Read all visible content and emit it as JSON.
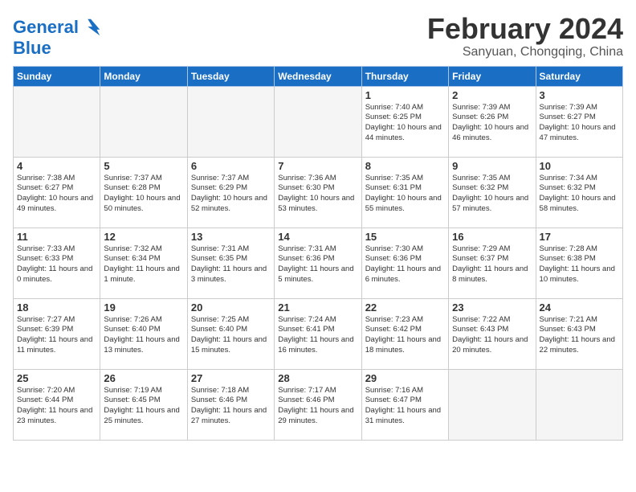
{
  "header": {
    "logo_line1": "General",
    "logo_line2": "Blue",
    "month_year": "February 2024",
    "location": "Sanyuan, Chongqing, China"
  },
  "weekdays": [
    "Sunday",
    "Monday",
    "Tuesday",
    "Wednesday",
    "Thursday",
    "Friday",
    "Saturday"
  ],
  "weeks": [
    [
      {
        "day": "",
        "sunrise": "",
        "sunset": "",
        "daylight": ""
      },
      {
        "day": "",
        "sunrise": "",
        "sunset": "",
        "daylight": ""
      },
      {
        "day": "",
        "sunrise": "",
        "sunset": "",
        "daylight": ""
      },
      {
        "day": "",
        "sunrise": "",
        "sunset": "",
        "daylight": ""
      },
      {
        "day": "1",
        "sunrise": "7:40 AM",
        "sunset": "6:25 PM",
        "daylight": "10 hours and 44 minutes."
      },
      {
        "day": "2",
        "sunrise": "7:39 AM",
        "sunset": "6:26 PM",
        "daylight": "10 hours and 46 minutes."
      },
      {
        "day": "3",
        "sunrise": "7:39 AM",
        "sunset": "6:27 PM",
        "daylight": "10 hours and 47 minutes."
      }
    ],
    [
      {
        "day": "4",
        "sunrise": "7:38 AM",
        "sunset": "6:27 PM",
        "daylight": "10 hours and 49 minutes."
      },
      {
        "day": "5",
        "sunrise": "7:37 AM",
        "sunset": "6:28 PM",
        "daylight": "10 hours and 50 minutes."
      },
      {
        "day": "6",
        "sunrise": "7:37 AM",
        "sunset": "6:29 PM",
        "daylight": "10 hours and 52 minutes."
      },
      {
        "day": "7",
        "sunrise": "7:36 AM",
        "sunset": "6:30 PM",
        "daylight": "10 hours and 53 minutes."
      },
      {
        "day": "8",
        "sunrise": "7:35 AM",
        "sunset": "6:31 PM",
        "daylight": "10 hours and 55 minutes."
      },
      {
        "day": "9",
        "sunrise": "7:35 AM",
        "sunset": "6:32 PM",
        "daylight": "10 hours and 57 minutes."
      },
      {
        "day": "10",
        "sunrise": "7:34 AM",
        "sunset": "6:32 PM",
        "daylight": "10 hours and 58 minutes."
      }
    ],
    [
      {
        "day": "11",
        "sunrise": "7:33 AM",
        "sunset": "6:33 PM",
        "daylight": "11 hours and 0 minutes."
      },
      {
        "day": "12",
        "sunrise": "7:32 AM",
        "sunset": "6:34 PM",
        "daylight": "11 hours and 1 minute."
      },
      {
        "day": "13",
        "sunrise": "7:31 AM",
        "sunset": "6:35 PM",
        "daylight": "11 hours and 3 minutes."
      },
      {
        "day": "14",
        "sunrise": "7:31 AM",
        "sunset": "6:36 PM",
        "daylight": "11 hours and 5 minutes."
      },
      {
        "day": "15",
        "sunrise": "7:30 AM",
        "sunset": "6:36 PM",
        "daylight": "11 hours and 6 minutes."
      },
      {
        "day": "16",
        "sunrise": "7:29 AM",
        "sunset": "6:37 PM",
        "daylight": "11 hours and 8 minutes."
      },
      {
        "day": "17",
        "sunrise": "7:28 AM",
        "sunset": "6:38 PM",
        "daylight": "11 hours and 10 minutes."
      }
    ],
    [
      {
        "day": "18",
        "sunrise": "7:27 AM",
        "sunset": "6:39 PM",
        "daylight": "11 hours and 11 minutes."
      },
      {
        "day": "19",
        "sunrise": "7:26 AM",
        "sunset": "6:40 PM",
        "daylight": "11 hours and 13 minutes."
      },
      {
        "day": "20",
        "sunrise": "7:25 AM",
        "sunset": "6:40 PM",
        "daylight": "11 hours and 15 minutes."
      },
      {
        "day": "21",
        "sunrise": "7:24 AM",
        "sunset": "6:41 PM",
        "daylight": "11 hours and 16 minutes."
      },
      {
        "day": "22",
        "sunrise": "7:23 AM",
        "sunset": "6:42 PM",
        "daylight": "11 hours and 18 minutes."
      },
      {
        "day": "23",
        "sunrise": "7:22 AM",
        "sunset": "6:43 PM",
        "daylight": "11 hours and 20 minutes."
      },
      {
        "day": "24",
        "sunrise": "7:21 AM",
        "sunset": "6:43 PM",
        "daylight": "11 hours and 22 minutes."
      }
    ],
    [
      {
        "day": "25",
        "sunrise": "7:20 AM",
        "sunset": "6:44 PM",
        "daylight": "11 hours and 23 minutes."
      },
      {
        "day": "26",
        "sunrise": "7:19 AM",
        "sunset": "6:45 PM",
        "daylight": "11 hours and 25 minutes."
      },
      {
        "day": "27",
        "sunrise": "7:18 AM",
        "sunset": "6:46 PM",
        "daylight": "11 hours and 27 minutes."
      },
      {
        "day": "28",
        "sunrise": "7:17 AM",
        "sunset": "6:46 PM",
        "daylight": "11 hours and 29 minutes."
      },
      {
        "day": "29",
        "sunrise": "7:16 AM",
        "sunset": "6:47 PM",
        "daylight": "11 hours and 31 minutes."
      },
      {
        "day": "",
        "sunrise": "",
        "sunset": "",
        "daylight": ""
      },
      {
        "day": "",
        "sunrise": "",
        "sunset": "",
        "daylight": ""
      }
    ]
  ]
}
